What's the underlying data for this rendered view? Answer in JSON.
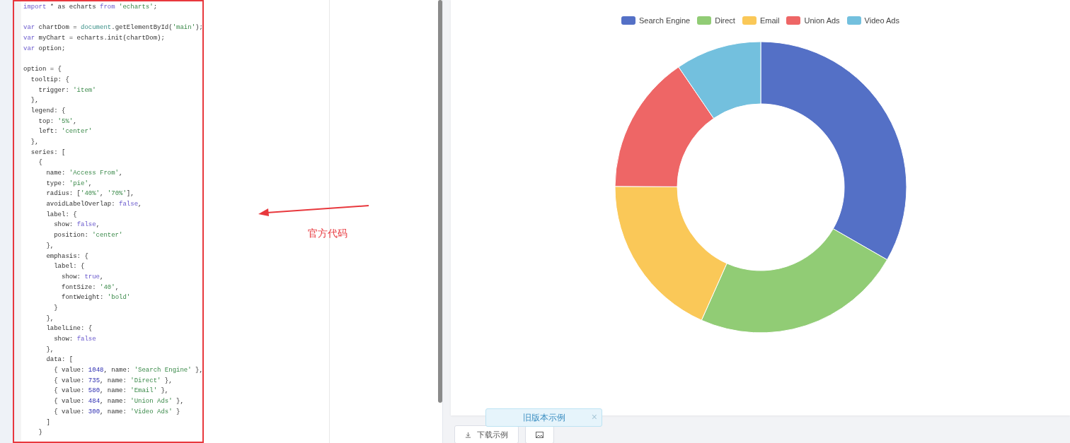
{
  "code": {
    "blocks": [
      [
        {
          "tokens": [
            {
              "kind": "kw",
              "text": "import"
            },
            {
              "kind": "plain",
              "text": " * as echarts "
            },
            {
              "kind": "kw",
              "text": "from"
            },
            {
              "kind": "str",
              "text": " 'echarts'"
            },
            {
              "kind": "plain",
              "text": ";"
            }
          ]
        }
      ],
      [
        {
          "tokens": [
            {
              "kind": "kw",
              "text": "var"
            },
            {
              "kind": "plain",
              "text": " chartDom = "
            },
            {
              "kind": "fn",
              "text": "document"
            },
            {
              "kind": "plain",
              "text": ".getElementById("
            },
            {
              "kind": "str",
              "text": "'main'"
            },
            {
              "kind": "plain",
              "text": ");"
            }
          ]
        },
        {
          "tokens": [
            {
              "kind": "kw",
              "text": "var"
            },
            {
              "kind": "plain",
              "text": " myChart = echarts.init(chartDom);"
            }
          ]
        },
        {
          "tokens": [
            {
              "kind": "kw",
              "text": "var"
            },
            {
              "kind": "plain",
              "text": " option;"
            }
          ]
        }
      ],
      [
        {
          "tokens": [
            {
              "kind": "plain",
              "text": "option = {"
            }
          ]
        },
        {
          "tokens": [
            {
              "kind": "plain",
              "text": "  tooltip: {"
            }
          ]
        },
        {
          "tokens": [
            {
              "kind": "plain",
              "text": "    trigger: "
            },
            {
              "kind": "str",
              "text": "'item'"
            }
          ]
        },
        {
          "tokens": [
            {
              "kind": "plain",
              "text": "  },"
            }
          ]
        },
        {
          "tokens": [
            {
              "kind": "plain",
              "text": "  legend: {"
            }
          ]
        },
        {
          "tokens": [
            {
              "kind": "plain",
              "text": "    top: "
            },
            {
              "kind": "str",
              "text": "'5%'"
            },
            {
              "kind": "plain",
              "text": ","
            }
          ]
        },
        {
          "tokens": [
            {
              "kind": "plain",
              "text": "    left: "
            },
            {
              "kind": "str",
              "text": "'center'"
            }
          ]
        },
        {
          "tokens": [
            {
              "kind": "plain",
              "text": "  },"
            }
          ]
        },
        {
          "tokens": [
            {
              "kind": "plain",
              "text": "  series: ["
            }
          ]
        },
        {
          "tokens": [
            {
              "kind": "plain",
              "text": "    {"
            }
          ]
        },
        {
          "tokens": [
            {
              "kind": "plain",
              "text": "      name: "
            },
            {
              "kind": "str",
              "text": "'Access From'"
            },
            {
              "kind": "plain",
              "text": ","
            }
          ]
        },
        {
          "tokens": [
            {
              "kind": "plain",
              "text": "      type: "
            },
            {
              "kind": "str",
              "text": "'pie'"
            },
            {
              "kind": "plain",
              "text": ","
            }
          ]
        },
        {
          "tokens": [
            {
              "kind": "plain",
              "text": "      radius: ["
            },
            {
              "kind": "str",
              "text": "'40%'"
            },
            {
              "kind": "plain",
              "text": ", "
            },
            {
              "kind": "str",
              "text": "'70%'"
            },
            {
              "kind": "plain",
              "text": "],"
            }
          ]
        },
        {
          "tokens": [
            {
              "kind": "plain",
              "text": "      avoidLabelOverlap: "
            },
            {
              "kind": "kw",
              "text": "false"
            },
            {
              "kind": "plain",
              "text": ","
            }
          ]
        },
        {
          "tokens": [
            {
              "kind": "plain",
              "text": "      label: {"
            }
          ]
        },
        {
          "tokens": [
            {
              "kind": "plain",
              "text": "        show: "
            },
            {
              "kind": "kw",
              "text": "false"
            },
            {
              "kind": "plain",
              "text": ","
            }
          ]
        },
        {
          "tokens": [
            {
              "kind": "plain",
              "text": "        position: "
            },
            {
              "kind": "str",
              "text": "'center'"
            }
          ]
        },
        {
          "tokens": [
            {
              "kind": "plain",
              "text": "      },"
            }
          ]
        },
        {
          "tokens": [
            {
              "kind": "plain",
              "text": "      emphasis: {"
            }
          ]
        },
        {
          "tokens": [
            {
              "kind": "plain",
              "text": "        label: {"
            }
          ]
        },
        {
          "tokens": [
            {
              "kind": "plain",
              "text": "          show: "
            },
            {
              "kind": "kw",
              "text": "true"
            },
            {
              "kind": "plain",
              "text": ","
            }
          ]
        },
        {
          "tokens": [
            {
              "kind": "plain",
              "text": "          fontSize: "
            },
            {
              "kind": "str",
              "text": "'40'"
            },
            {
              "kind": "plain",
              "text": ","
            }
          ]
        },
        {
          "tokens": [
            {
              "kind": "plain",
              "text": "          fontWeight: "
            },
            {
              "kind": "str",
              "text": "'bold'"
            }
          ]
        },
        {
          "tokens": [
            {
              "kind": "plain",
              "text": "        }"
            }
          ]
        },
        {
          "tokens": [
            {
              "kind": "plain",
              "text": "      },"
            }
          ]
        },
        {
          "tokens": [
            {
              "kind": "plain",
              "text": "      labelLine: {"
            }
          ]
        },
        {
          "tokens": [
            {
              "kind": "plain",
              "text": "        show: "
            },
            {
              "kind": "kw",
              "text": "false"
            }
          ]
        },
        {
          "tokens": [
            {
              "kind": "plain",
              "text": "      },"
            }
          ]
        },
        {
          "tokens": [
            {
              "kind": "plain",
              "text": "      data: ["
            }
          ]
        },
        {
          "tokens": [
            {
              "kind": "plain",
              "text": "        { value: "
            },
            {
              "kind": "num",
              "text": "1048"
            },
            {
              "kind": "plain",
              "text": ", name: "
            },
            {
              "kind": "str",
              "text": "'Search Engine'"
            },
            {
              "kind": "plain",
              "text": " },"
            }
          ]
        },
        {
          "tokens": [
            {
              "kind": "plain",
              "text": "        { value: "
            },
            {
              "kind": "num",
              "text": "735"
            },
            {
              "kind": "plain",
              "text": ", name: "
            },
            {
              "kind": "str",
              "text": "'Direct'"
            },
            {
              "kind": "plain",
              "text": " },"
            }
          ]
        },
        {
          "tokens": [
            {
              "kind": "plain",
              "text": "        { value: "
            },
            {
              "kind": "num",
              "text": "580"
            },
            {
              "kind": "plain",
              "text": ", name: "
            },
            {
              "kind": "str",
              "text": "'Email'"
            },
            {
              "kind": "plain",
              "text": " },"
            }
          ]
        },
        {
          "tokens": [
            {
              "kind": "plain",
              "text": "        { value: "
            },
            {
              "kind": "num",
              "text": "484"
            },
            {
              "kind": "plain",
              "text": ", name: "
            },
            {
              "kind": "str",
              "text": "'Union Ads'"
            },
            {
              "kind": "plain",
              "text": " },"
            }
          ]
        },
        {
          "tokens": [
            {
              "kind": "plain",
              "text": "        { value: "
            },
            {
              "kind": "num",
              "text": "300"
            },
            {
              "kind": "plain",
              "text": ", name: "
            },
            {
              "kind": "str",
              "text": "'Video Ads'"
            },
            {
              "kind": "plain",
              "text": " }"
            }
          ]
        },
        {
          "tokens": [
            {
              "kind": "plain",
              "text": "      ]"
            }
          ]
        },
        {
          "tokens": [
            {
              "kind": "plain",
              "text": "    }"
            }
          ]
        }
      ]
    ]
  },
  "annotation": {
    "text": "官方代码"
  },
  "chart": {
    "legend": [
      {
        "color": "#5470c6"
      },
      {
        "color": "#91cc75"
      },
      {
        "color": "#fac858"
      },
      {
        "color": "#ee6666"
      },
      {
        "color": "#73c0de"
      }
    ],
    "chart_data": {
      "type": "donut",
      "categories": [
        "Search Engine",
        "Direct",
        "Email",
        "Union Ads",
        "Video Ads"
      ],
      "values": [
        33.3,
        23.36,
        18.43,
        15.38,
        9.53
      ]
    }
  },
  "toolbar": {
    "download_button": "下载示例"
  },
  "toast": {
    "text": "旧版本示例",
    "close": "×"
  }
}
